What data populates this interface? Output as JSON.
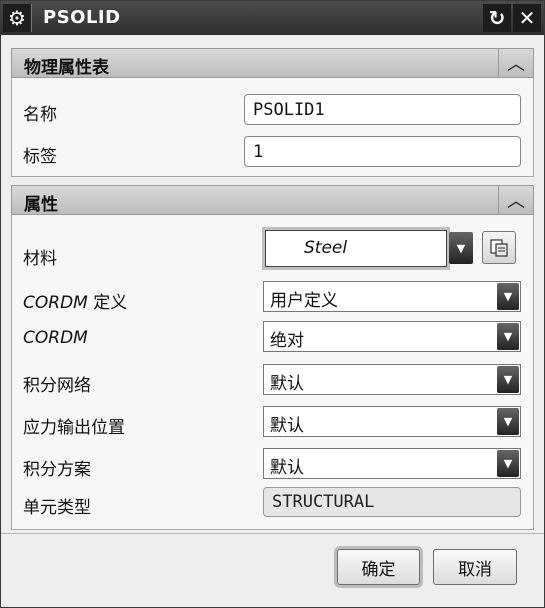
{
  "window": {
    "title": "PSOLID",
    "gear_icon": "gear-icon",
    "reset_icon": "reset-icon",
    "close_icon": "close-icon"
  },
  "physical_section": {
    "title": "物理属性表",
    "collapse_icon": "chevron-up-icon",
    "name_label": "名称",
    "name_value": "PSOLID1",
    "tag_label": "标签",
    "tag_value": "1"
  },
  "properties_section": {
    "title": "属性",
    "collapse_icon": "chevron-up-icon",
    "material": {
      "label": "材料",
      "value": "Steel",
      "browse_icon": "material-library-icon"
    },
    "cordm_def": {
      "label_italic": "CORDM",
      "label_suffix": " 定义",
      "value": "用户定义"
    },
    "cordm": {
      "label_italic": "CORDM",
      "value": "绝对"
    },
    "integration_network": {
      "label": "积分网络",
      "value": "默认"
    },
    "stress_output_location": {
      "label": "应力输出位置",
      "value": "默认"
    },
    "integration_scheme": {
      "label": "积分方案",
      "value": "默认"
    },
    "element_type": {
      "label": "单元类型",
      "value": "STRUCTURAL"
    }
  },
  "footer": {
    "ok_label": "确定",
    "cancel_label": "取消"
  }
}
